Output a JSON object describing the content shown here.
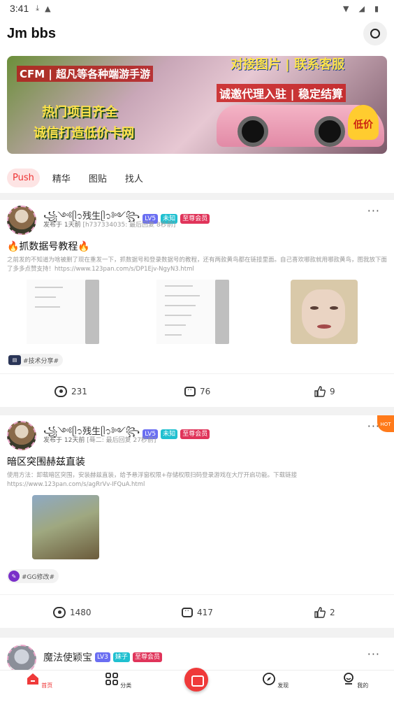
{
  "status_bar": {
    "time": "3:41",
    "icons": [
      "download-icon",
      "a-icon",
      "wifi-icon",
      "signal-icon",
      "battery-icon"
    ]
  },
  "header": {
    "title": "Jm bbs"
  },
  "banner": {
    "line1": "CFM | 超凡等各种端游手游",
    "line2": "热门项目齐全",
    "line3": "诚信打造低价卡网",
    "line4": "诚邀代理入驻 | 稳定结算",
    "line5": "对接图片 | 联系客服",
    "badge": "低价"
  },
  "tabs": [
    {
      "label": "Push",
      "active": true
    },
    {
      "label": "精华",
      "active": false
    },
    {
      "label": "图贴",
      "active": false
    },
    {
      "label": "找人",
      "active": false
    }
  ],
  "posts": [
    {
      "user": "꧁༺ᥫ᭡残生ᥫ᭡༻꧂",
      "level": "LV5",
      "gender_tag": "未知",
      "vip_tag": "至尊会员",
      "meta": "发布于 1天前",
      "meta_extra": "[h737334035: 最后回复 8秒前]",
      "title": "🔥抓数据号教程🔥",
      "body": "之前发的不知道为啥被删了现在重发一下，抓数据号和登录数据号的教程，还有两款黄鸟都在链接里面。自己喜欢哪款就用哪款黄鸟，图我放下面了多多点赞支持！https://www.123pan.com/s/DP1Ejv-NgyN3.html",
      "topic": "#技术分享#",
      "views": "231",
      "comments": "76",
      "likes": "9"
    },
    {
      "user": "꧁༺ᥫ᭡残生ᥫ᭡༻꧂",
      "level": "LV5",
      "gender_tag": "未知",
      "vip_tag": "至尊会员",
      "meta": "发布于 12天前",
      "meta_extra": "[蓦二: 最后回复 27秒前]",
      "title": "暗区突围赫兹直装",
      "body": "使用方法：卸载暗区突围，安装赫兹直装，给予悬浮窗权限+存储权限扫码登录游戏在大厅开启功能。下载链接 https://www.123pan.com/s/agRrVv-IFQuA.html",
      "topic": "#GG修改#",
      "views": "1480",
      "comments": "417",
      "likes": "2",
      "hot": "HOT"
    },
    {
      "user": "魔法使颖宝",
      "level": "LV3",
      "gender_tag": "妹子",
      "vip_tag": "至尊会员"
    }
  ],
  "bottom_nav": [
    {
      "label": "首页",
      "icon": "home-icon",
      "active": true
    },
    {
      "label": "分类",
      "icon": "grid-icon",
      "active": false
    },
    {
      "label": "",
      "icon": "post-icon",
      "active": false
    },
    {
      "label": "发现",
      "icon": "compass-icon",
      "active": false
    },
    {
      "label": "我的",
      "icon": "profile-icon",
      "active": false
    }
  ],
  "colors": {
    "accent": "#e33333",
    "vip": "#e0345a",
    "level": "#6a6ef2",
    "tag": "#20c0d0"
  }
}
